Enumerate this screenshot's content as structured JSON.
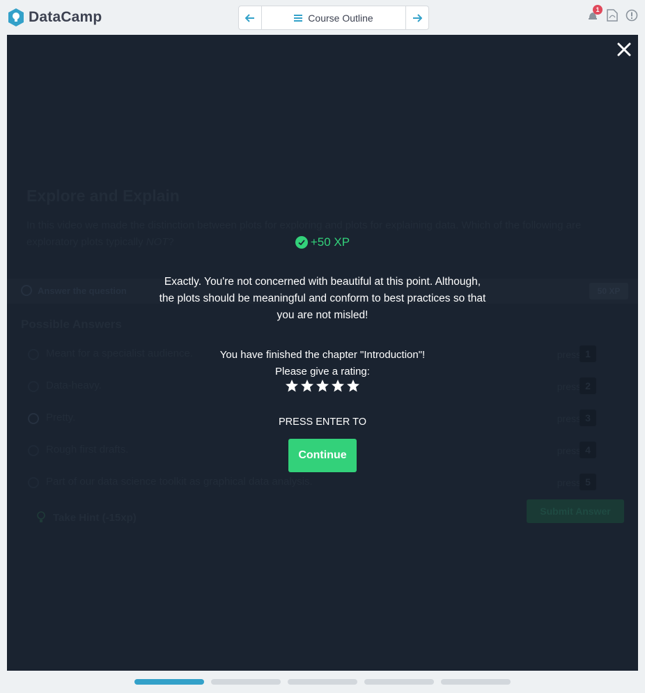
{
  "app": {
    "logo_text": "DataCamp"
  },
  "header": {
    "course_outline_label": "Course Outline",
    "notification_count": "1"
  },
  "background_exercise": {
    "title": "Explore and Explain",
    "description_main": "In this video we made the distinction between plots for exploring and plots for explaining data. Which of the following are exploratory plots typically ",
    "description_emph": "NOT",
    "description_end": "?",
    "bar_label": "Answer the question",
    "xp_badge": "50 XP",
    "possible_answers_label": "Possible Answers",
    "press_label": "press",
    "answers": [
      {
        "text": "Meant for a specialist audience.",
        "key": "1"
      },
      {
        "text": "Data-heavy.",
        "key": "2"
      },
      {
        "text": "Pretty.",
        "key": "3"
      },
      {
        "text": "Rough first drafts.",
        "key": "4"
      },
      {
        "text": "Part of our data science toolkit as graphical data analysis.",
        "key": "5"
      }
    ],
    "hint_label": "Take Hint (-15xp)",
    "submit_label": "Submit Answer"
  },
  "modal": {
    "xp_text": "+50 XP",
    "feedback": "Exactly. You're not concerned with beautiful at this point. Although, the plots should be meaningful and conform to best practices so that you are not misled!",
    "finished_text": "You have finished the chapter \"Introduction\"!",
    "rating_prompt": "Please give a rating:",
    "star_count": 5,
    "press_enter": "PRESS ENTER TO",
    "continue_label": "Continue"
  },
  "colors": {
    "accent_green": "#33d17a",
    "panel_bg": "#1a2330",
    "brand_blue": "#33a1c9",
    "badge_red": "#e0495b"
  },
  "progress": {
    "segments": 5,
    "active_index": 0
  }
}
